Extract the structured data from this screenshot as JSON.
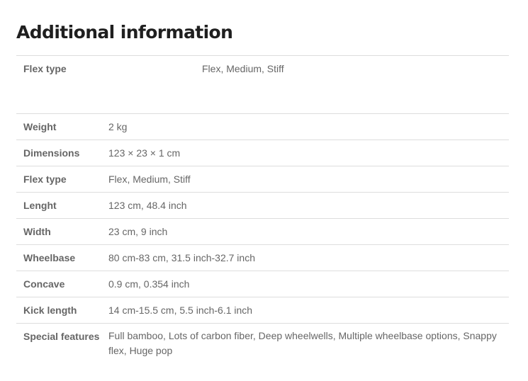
{
  "title": "Additional information",
  "top_row": {
    "label": "Flex type",
    "value": "Flex, Medium, Stiff"
  },
  "rows": [
    {
      "label": "Weight",
      "value": "2 kg"
    },
    {
      "label": "Dimensions",
      "value": "123 × 23 × 1 cm"
    },
    {
      "label": "Flex type",
      "value": "Flex, Medium, Stiff"
    },
    {
      "label": "Lenght",
      "value": "123 cm, 48.4 inch"
    },
    {
      "label": "Width",
      "value": "23 cm, 9 inch"
    },
    {
      "label": "Wheelbase",
      "value": "80 cm-83 cm, 31.5 inch-32.7 inch"
    },
    {
      "label": "Concave",
      "value": "0.9 cm, 0.354 inch"
    },
    {
      "label": "Kick length",
      "value": "14 cm-15.5 cm, 5.5 inch-6.1 inch"
    },
    {
      "label": "Special features",
      "value": "Full bamboo, Lots of carbon fiber, Deep wheelwells, Multiple wheelbase options, Snappy flex, Huge pop"
    }
  ]
}
